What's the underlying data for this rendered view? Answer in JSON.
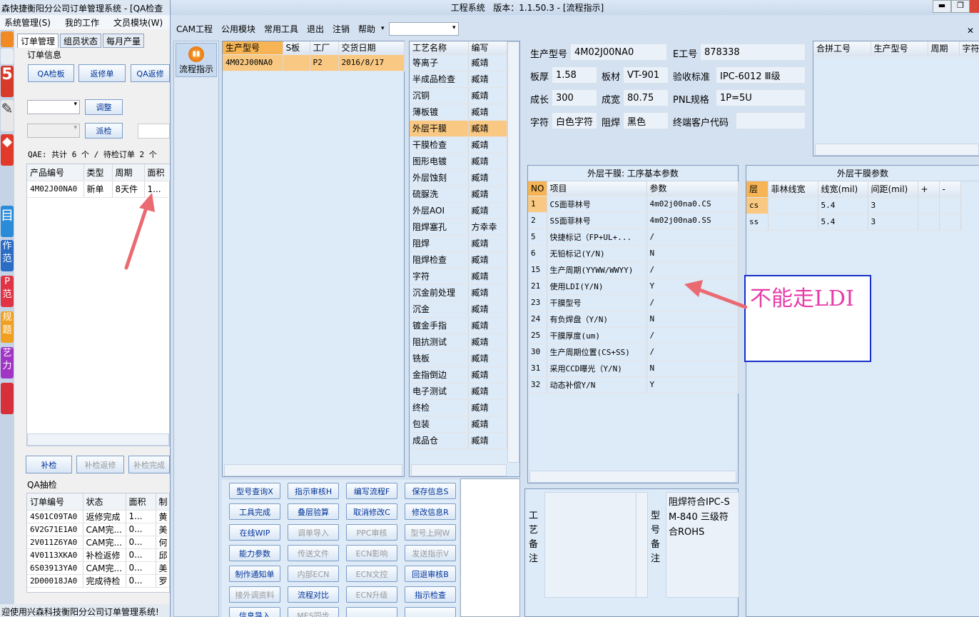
{
  "back": {
    "title": "森快捷衡阳分公司订单管理系统 - [QA检查",
    "menu": [
      "系统管理(S)",
      "我的工作",
      "文员模块(W)"
    ],
    "tabs": [
      "订单管理",
      "组员状态",
      "每月产量"
    ],
    "order_info_label": "订单信息",
    "buttons_row1": [
      "QA检板",
      "返修单",
      "QA返修"
    ],
    "adjust_btn": "调整",
    "dispatch_btn": "派检",
    "qae_summary": "QAE: 共计 6 个 / 待检订单 2 个",
    "table1": {
      "headers": [
        "产品编号",
        "类型",
        "周期",
        "面积"
      ],
      "rows": [
        [
          "4M02J00NA0",
          "新单",
          "8天件",
          "1..."
        ]
      ]
    },
    "bottom_buttons": [
      "补检",
      "补检返修",
      "补检完成"
    ],
    "qa_check_label": "QA抽检",
    "table2": {
      "headers": [
        "订单编号",
        "状态",
        "面积",
        "制"
      ],
      "rows": [
        [
          "4S01C09TA0",
          "返修完成",
          "1...",
          "黄"
        ],
        [
          "6V2G71E1A0",
          "CAM完...",
          "0...",
          "美"
        ],
        [
          "2V011Z6YA0",
          "CAM完...",
          "0...",
          "何"
        ],
        [
          "4V0113XKA0",
          "补检返修",
          "0...",
          "邱"
        ],
        [
          "6S03913YA0",
          "CAM完...",
          "0...",
          "美"
        ],
        [
          "2D00018JA0",
          "完成待检",
          "0...",
          "罗"
        ]
      ]
    },
    "status": "迎使用兴森科技衡阳分公司订单管理系统!",
    "side_icons": [
      "5",
      "",
      "",
      "目",
      "作\n范",
      "P\n范",
      "规\n题",
      "艺\n力",
      ""
    ]
  },
  "front": {
    "title": "工程系统   版本：1.1.50.3 - [流程指示]",
    "menu": [
      "CAM工程",
      "公用模块",
      "常用工具",
      "退出",
      "注销",
      "帮助"
    ],
    "nav_label": "流程指示",
    "orders": {
      "headers": [
        "生产型号",
        "S板",
        "工厂",
        "交货日期"
      ],
      "rows": [
        [
          "4M02J00NA0",
          "",
          "P2",
          "2016/8/17"
        ]
      ]
    },
    "process": {
      "headers": [
        "工艺名称",
        "编写"
      ],
      "rows": [
        [
          "等离子",
          "臧靖"
        ],
        [
          "半成品检查",
          "臧靖"
        ],
        [
          "沉铜",
          "臧靖"
        ],
        [
          "薄板镀",
          "臧靖"
        ],
        [
          "外层干膜",
          "臧靖"
        ],
        [
          "干膜检查",
          "臧靖"
        ],
        [
          "图形电镀",
          "臧靖"
        ],
        [
          "外层蚀刻",
          "臧靖"
        ],
        [
          "硫脲洗",
          "臧靖"
        ],
        [
          "外层AOI",
          "臧靖"
        ],
        [
          "阻焊塞孔",
          "方幸幸"
        ],
        [
          "阻焊",
          "臧靖"
        ],
        [
          "阻焊检查",
          "臧靖"
        ],
        [
          "字符",
          "臧靖"
        ],
        [
          "沉金前处理",
          "臧靖"
        ],
        [
          "沉金",
          "臧靖"
        ],
        [
          "镀金手指",
          "臧靖"
        ],
        [
          "阻抗测试",
          "臧靖"
        ],
        [
          "铣板",
          "臧靖"
        ],
        [
          "金指倒边",
          "臧靖"
        ],
        [
          "电子测试",
          "臧靖"
        ],
        [
          "终检",
          "臧靖"
        ],
        [
          "包装",
          "臧靖"
        ],
        [
          "成品仓",
          "臧靖"
        ]
      ]
    },
    "info": {
      "model_label": "生产型号",
      "model": "4M02J00NA0",
      "e_label": "E工号",
      "e_no": "878338",
      "thick_label": "板厚",
      "thick": "1.58",
      "mat_label": "板材",
      "mat": "VT-901",
      "std_label": "验收标准",
      "std": "IPC-6012 Ⅲ级",
      "len_label": "成长",
      "len": "300",
      "wid_label": "成宽",
      "wid": "80.75",
      "pnl_label": "PNL规格",
      "pnl": "1P=5U",
      "char_label": "字符",
      "char": "白色字符",
      "mask_label": "阻焊",
      "mask": "黑色",
      "cust_label": "终端客户代码",
      "cust": ""
    },
    "combine": {
      "headers": [
        "合拼工号",
        "生产型号",
        "周期",
        "字符"
      ]
    },
    "params": {
      "title": "外层干膜: 工序基本参数",
      "headers": [
        "NO",
        "项目",
        "参数"
      ],
      "rows": [
        [
          "1",
          "CS面菲林号",
          "4m02j00na0.CS"
        ],
        [
          "2",
          "SS面菲林号",
          "4m02j00na0.SS"
        ],
        [
          "5",
          "快捷标记（FP+UL+...",
          "/"
        ],
        [
          "6",
          "无铅标记(Y/N)",
          "N"
        ],
        [
          "15",
          "生产周期(YYWW/WWYY)",
          "/"
        ],
        [
          "21",
          "使用LDI(Y/N)",
          "Y"
        ],
        [
          "23",
          "干膜型号",
          "/"
        ],
        [
          "24",
          "有负焊盘（Y/N)",
          "N"
        ],
        [
          "25",
          "干膜厚度(um)",
          "/"
        ],
        [
          "30",
          "生产周期位置(CS+SS)",
          "/"
        ],
        [
          "31",
          "采用CCD曝光（Y/N)",
          "N"
        ],
        [
          "32",
          "动态补偿Y/N",
          "Y"
        ]
      ]
    },
    "film": {
      "title": "外层干膜参数",
      "headers": [
        "层",
        "菲林线宽",
        "线宽(mil)",
        "间距(mil)",
        "+",
        "-"
      ],
      "rows": [
        [
          "cs",
          "",
          "5.4",
          "3",
          "",
          ""
        ],
        [
          "ss",
          "",
          "5.4",
          "3",
          "",
          ""
        ]
      ]
    },
    "annotation": "不能走LDI",
    "buttons": [
      [
        "型号查询X",
        "指示审核H",
        "编写流程F",
        "保存信息S"
      ],
      [
        "工具完成",
        "叠层验算",
        "取消修改C",
        "修改信息R"
      ],
      [
        "在线WIP",
        "调单导入",
        "PPC审核",
        "型号上网W"
      ],
      [
        "能力参数",
        "传送文件",
        "ECN影响",
        "发送指示V"
      ],
      [
        "制作通知单",
        "内部ECN",
        "ECN文控",
        "回退审核B"
      ],
      [
        "接外调资料",
        "流程对比",
        "ECN升级",
        "指示检查"
      ],
      [
        "信息导入",
        "MES同步",
        "",
        ""
      ]
    ],
    "disabled": [
      [
        false,
        false,
        false,
        false
      ],
      [
        false,
        false,
        false,
        false
      ],
      [
        false,
        true,
        true,
        true
      ],
      [
        false,
        true,
        true,
        true
      ],
      [
        false,
        true,
        true,
        false
      ],
      [
        true,
        false,
        true,
        false
      ],
      [
        false,
        true,
        false,
        false
      ]
    ],
    "remark_label": "工艺备注",
    "model_remark_label": "型号备注",
    "model_remark": "阻焊符合IPC-SM-840 三级符合ROHS"
  }
}
